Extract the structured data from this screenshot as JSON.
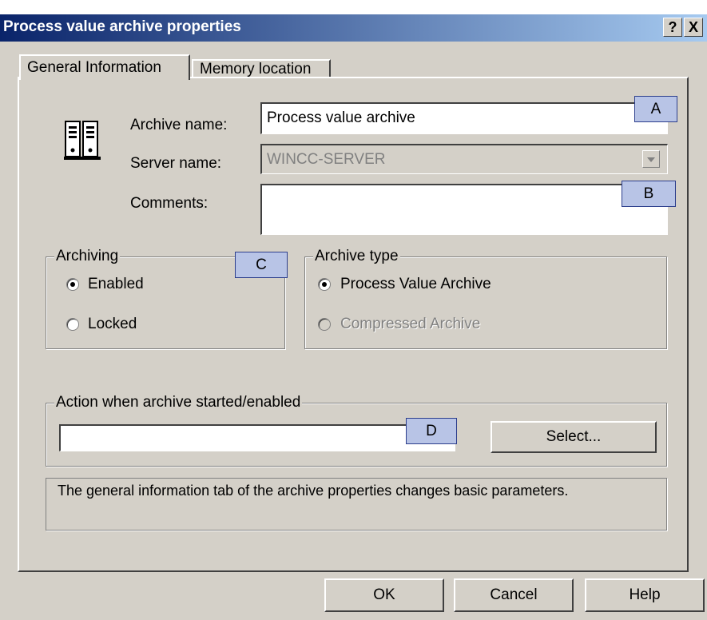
{
  "window": {
    "title": "Process value archive properties",
    "help_glyph": "?",
    "close_glyph": "X"
  },
  "tabs": [
    "General Information",
    "Memory location"
  ],
  "fields": {
    "archive_name_label": "Archive name:",
    "archive_name_value": "Process value archive",
    "server_name_label": "Server name:",
    "server_name_value": "WINCC-SERVER",
    "comments_label": "Comments:",
    "comments_value": ""
  },
  "archiving": {
    "legend": "Archiving",
    "enabled": "Enabled",
    "locked": "Locked",
    "selected": "Enabled"
  },
  "archive_type": {
    "legend": "Archive type",
    "process": "Process Value Archive",
    "compressed": "Compressed Archive",
    "selected": "Process Value Archive"
  },
  "action": {
    "legend": "Action when archive started/enabled",
    "value": "",
    "select_label": "Select..."
  },
  "info_text": "The general information tab of the archive properties changes basic parameters.",
  "callouts": [
    "A",
    "B",
    "C",
    "D"
  ],
  "buttons": {
    "ok": "OK",
    "cancel": "Cancel",
    "help": "Help"
  },
  "icons": {
    "archive": "archive-binders-icon",
    "dropdown": "chevron-down-icon"
  },
  "colors": {
    "titlebar_start": "#0a246a",
    "titlebar_end": "#a6caf0",
    "dialog": "#d4d0c8",
    "callout": "#b8c4e6"
  }
}
